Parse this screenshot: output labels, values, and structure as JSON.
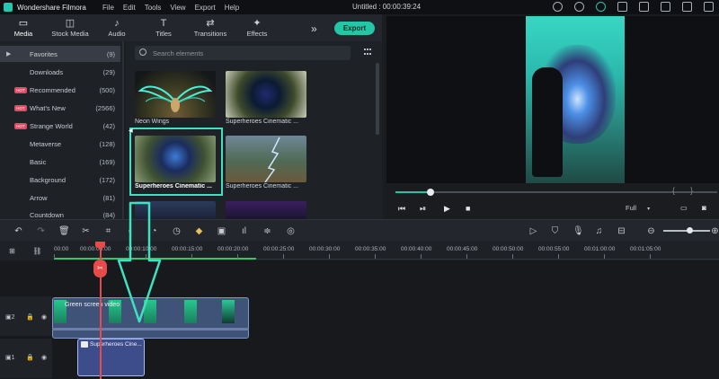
{
  "app": {
    "title": "Wondershare Filmora",
    "document_title": "Untitled : 00:00:39:24",
    "menus": [
      "File",
      "Edit",
      "Tools",
      "View",
      "Export",
      "Help"
    ]
  },
  "media_tabs": [
    {
      "label": "Media",
      "icon": "folder-icon",
      "glyph": "▭"
    },
    {
      "label": "Stock Media",
      "icon": "stock-media-icon",
      "glyph": "◫"
    },
    {
      "label": "Audio",
      "icon": "music-note-icon",
      "glyph": "♪"
    },
    {
      "label": "Titles",
      "icon": "titles-icon",
      "glyph": "T"
    },
    {
      "label": "Transitions",
      "icon": "transitions-icon",
      "glyph": "⇄"
    },
    {
      "label": "Effects",
      "icon": "effects-icon",
      "glyph": "✦"
    }
  ],
  "more_glyph": "»",
  "export_label": "Export",
  "sidebar": [
    {
      "label": "Favorites",
      "count": "(9)",
      "arrow": "▶",
      "active": true
    },
    {
      "label": "Downloads",
      "count": "(29)"
    },
    {
      "label": "Recommended",
      "count": "(500)",
      "badge": "HOT"
    },
    {
      "label": "What's New",
      "count": "(2566)",
      "badge": "HOT"
    },
    {
      "label": "Strange World",
      "count": "(42)",
      "badge": "HOT"
    },
    {
      "label": "Metaverse",
      "count": "(128)"
    },
    {
      "label": "Basic",
      "count": "(169)"
    },
    {
      "label": "Background",
      "count": "(172)"
    },
    {
      "label": "Arrow",
      "count": "(81)"
    },
    {
      "label": "Countdown",
      "count": "(84)"
    }
  ],
  "search": {
    "placeholder": "Search elements"
  },
  "thumbnails": [
    {
      "title": "Neon Wings"
    },
    {
      "title": "Superheroes Cinematic ..."
    },
    {
      "title": "Superheroes Cinematic ..."
    },
    {
      "title": "Superheroes Cinematic ..."
    }
  ],
  "player": {
    "progress": 0.11,
    "brace_left": "{",
    "brace_right": "}",
    "controls": [
      "⏮",
      "⏯",
      "▶",
      "■"
    ],
    "quality": "Full",
    "quality_dropdown": "▾"
  },
  "timeline": {
    "tools": [
      {
        "icon": "undo-icon",
        "glyph": "↶"
      },
      {
        "icon": "redo-icon",
        "glyph": "↷"
      },
      {
        "icon": "delete-icon",
        "glyph": "🗑"
      },
      {
        "icon": "cut-icon",
        "glyph": "✂"
      },
      {
        "icon": "crop-icon",
        "glyph": "⌗"
      },
      {
        "icon": "color-icon",
        "glyph": "◐"
      },
      {
        "icon": "speed-icon",
        "glyph": "◔"
      },
      {
        "icon": "timer-icon",
        "glyph": "◷"
      },
      {
        "icon": "keyframe-icon",
        "glyph": "◆"
      },
      {
        "icon": "green-screen-icon",
        "glyph": "▣"
      },
      {
        "icon": "audio-wave-icon",
        "glyph": "ıl"
      },
      {
        "icon": "adjust-icon",
        "glyph": "≑"
      },
      {
        "icon": "motion-tracking-icon",
        "glyph": "◎"
      },
      {
        "icon": "stabilize-icon",
        "glyph": "◉"
      }
    ],
    "right_tools": [
      {
        "icon": "render-icon",
        "glyph": "▷"
      },
      {
        "icon": "marker-icon",
        "glyph": "⛉"
      },
      {
        "icon": "mic-icon",
        "glyph": "🎙"
      },
      {
        "icon": "audio-mixer-icon",
        "glyph": "♫"
      },
      {
        "icon": "split-screen-icon",
        "glyph": "⊟"
      },
      {
        "icon": "zoom-out-icon",
        "glyph": "⊖"
      },
      {
        "icon": "zoom-in-icon",
        "glyph": "⊕"
      }
    ],
    "ruler": [
      "00:00",
      "00:00:05:00",
      "00:00:10:00",
      "00:00:15:00",
      "00:00:20:00",
      "00:00:25:00",
      "00:00:30:00",
      "00:00:35:00",
      "00:00:40:00",
      "00:00:45:00",
      "00:00:50:00",
      "00:00:55:00",
      "00:01:00:00",
      "00:01:05:00"
    ],
    "clips": {
      "video": "Green screen video",
      "effect": "Superheroes Cine..."
    },
    "cut_glyph": "✂"
  }
}
